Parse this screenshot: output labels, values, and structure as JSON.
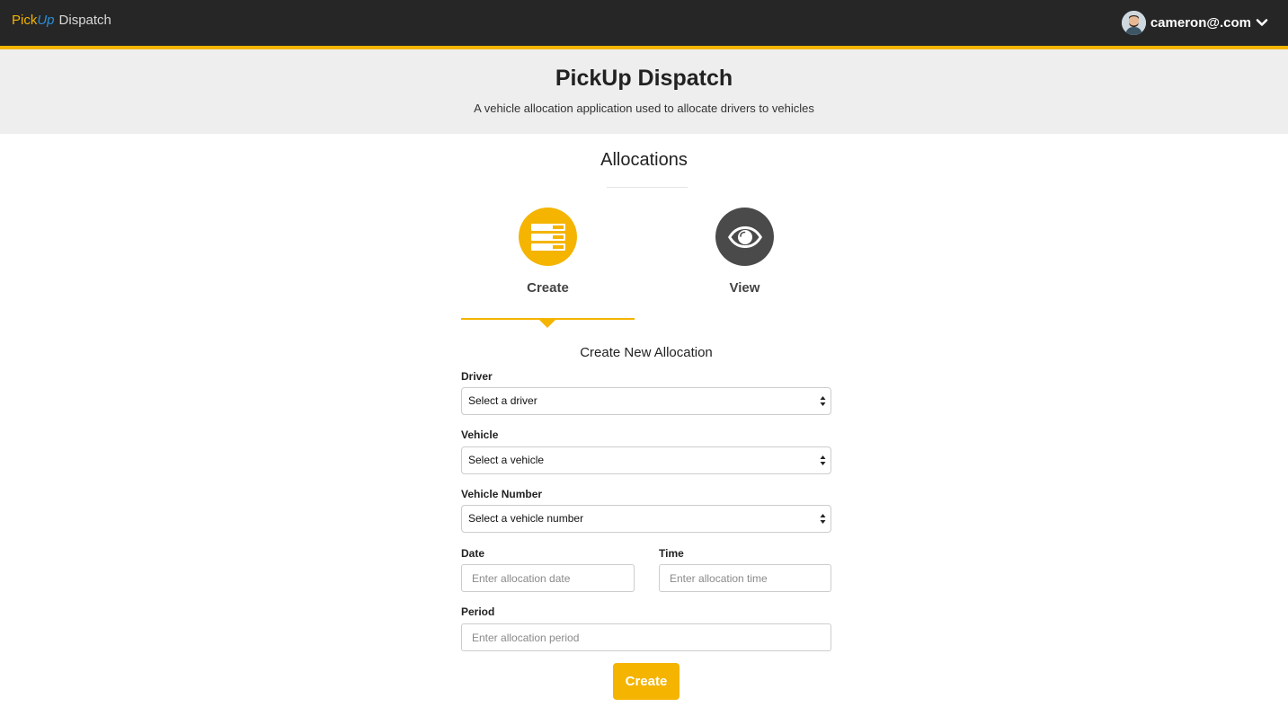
{
  "navbar": {
    "brand_part1": "Pick",
    "brand_part2": "Up",
    "brand_part3": "Dispatch",
    "user_email": "cameron@.com",
    "user_menu_icon": "chevron-down-icon",
    "avatar_icon": "user-avatar"
  },
  "hero": {
    "title": "PickUp Dispatch",
    "subtitle": "A vehicle allocation application used to allocate drivers to vehicles"
  },
  "section": {
    "title": "Allocations"
  },
  "tabs": [
    {
      "label": "Create",
      "icon": "list-form-icon",
      "active": true
    },
    {
      "label": "View",
      "icon": "eye-icon",
      "active": false
    }
  ],
  "form": {
    "title": "Create New Allocation",
    "driver": {
      "label": "Driver",
      "value": "Select a driver"
    },
    "vehicle": {
      "label": "Vehicle",
      "value": "Select a vehicle"
    },
    "vehicle_number": {
      "label": "Vehicle Number",
      "value": "Select a vehicle number"
    },
    "date": {
      "label": "Date",
      "placeholder": "Enter allocation date"
    },
    "time": {
      "label": "Time",
      "placeholder": "Enter allocation time"
    },
    "period": {
      "label": "Period",
      "placeholder": "Enter allocation period"
    },
    "submit_label": "Create"
  },
  "colors": {
    "accent": "#f4b400",
    "navbar": "#262626",
    "hero_bg": "#eeeeee",
    "view_circle": "#4a4a4a"
  }
}
